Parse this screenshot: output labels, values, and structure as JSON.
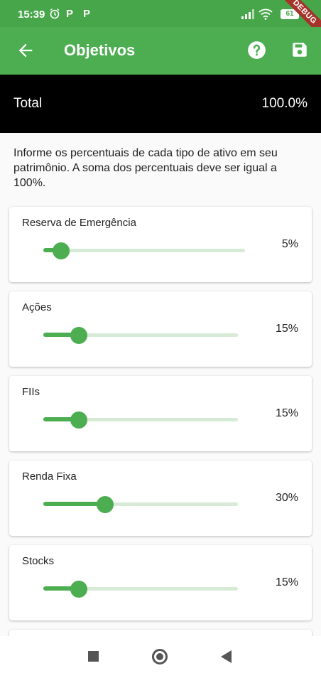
{
  "status_bar": {
    "time": "15:39",
    "notification_icons": [
      "alarm-icon",
      "p-icon",
      "p-icon"
    ],
    "p_letter": "P",
    "battery": "61",
    "debug_banner": "DEBUG"
  },
  "app_bar": {
    "title": "Objetivos",
    "icons": [
      "arrow-back-icon",
      "help-icon",
      "save-icon"
    ]
  },
  "total": {
    "label": "Total",
    "value": "100.0%"
  },
  "intro_text": "Informe os percentuais de cada tipo de ativo em seu patrimônio. A soma dos percentuais deve ser igual a 100%.",
  "allocations": [
    {
      "name": "Reserva de Emergência",
      "percent_label": "5%",
      "value": 5
    },
    {
      "name": "Ações",
      "percent_label": "15%",
      "value": 15
    },
    {
      "name": "FIIs",
      "percent_label": "15%",
      "value": 15
    },
    {
      "name": "Renda Fixa",
      "percent_label": "30%",
      "value": 30
    },
    {
      "name": "Stocks",
      "percent_label": "15%",
      "value": 15
    }
  ],
  "slider_max": 100,
  "colors": {
    "primary": "#4cae50",
    "status_bar": "#47a64a",
    "track_inactive": "#d6ead6",
    "total_bar": "#000000"
  },
  "nav_bar": [
    "recents-icon",
    "home-icon",
    "back-icon"
  ]
}
